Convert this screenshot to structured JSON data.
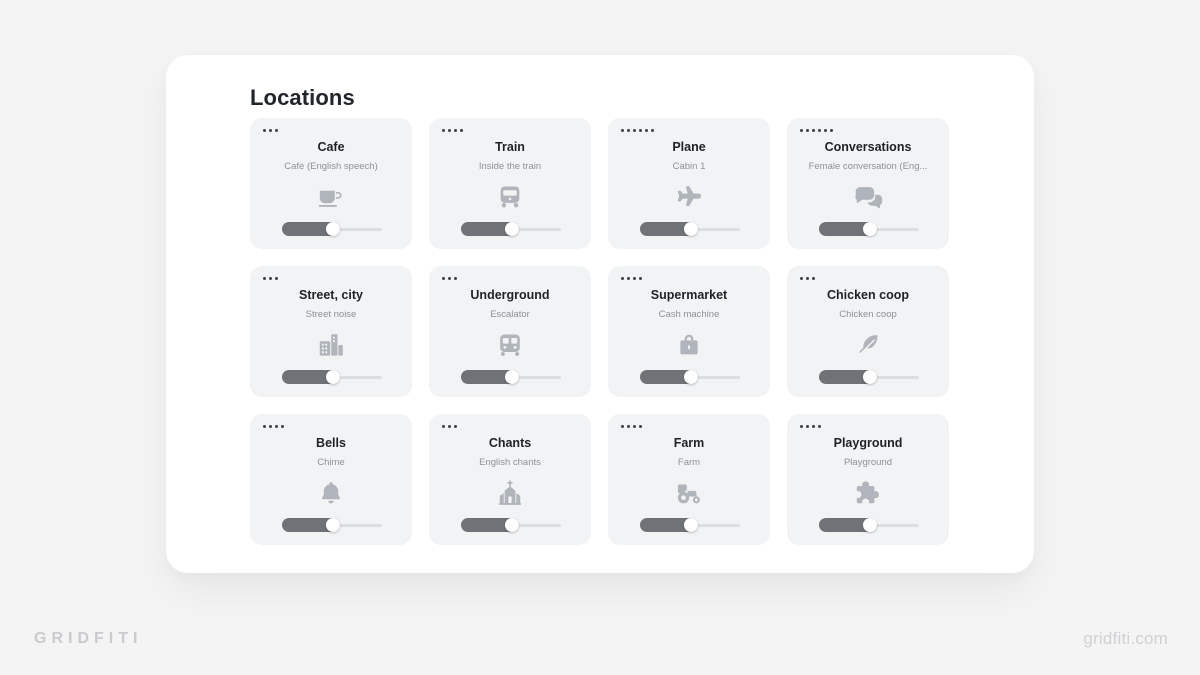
{
  "page": {
    "background_color": "#f4f4f4",
    "panel_color": "#ffffff",
    "card_color": "#f2f3f4",
    "slider_fill_color": "#6f7378",
    "slider_track_color": "#dcdee1"
  },
  "panel": {
    "title": "Locations"
  },
  "branding": {
    "left": "GRIDFITI",
    "right": "gridfiti.com"
  },
  "cards": [
    {
      "title": "Cafe",
      "subtitle": "Cafe (English speech)",
      "icon": "coffee-cup-icon",
      "dots": 3,
      "slider_percent": 58
    },
    {
      "title": "Train",
      "subtitle": "Inside the train",
      "icon": "train-front-icon",
      "dots": 4,
      "slider_percent": 58
    },
    {
      "title": "Plane",
      "subtitle": "Cabin 1",
      "icon": "airplane-icon",
      "dots": 6,
      "slider_percent": 58
    },
    {
      "title": "Conversations",
      "subtitle": "Female conversation (Eng...",
      "icon": "speech-bubbles-icon",
      "dots": 6,
      "slider_percent": 58
    },
    {
      "title": "Street, city",
      "subtitle": "Street noise",
      "icon": "city-buildings-icon",
      "dots": 3,
      "slider_percent": 58
    },
    {
      "title": "Underground",
      "subtitle": "Escalator",
      "icon": "metro-train-icon",
      "dots": 3,
      "slider_percent": 58
    },
    {
      "title": "Supermarket",
      "subtitle": "Cash machine",
      "icon": "shopping-bag-icon",
      "dots": 4,
      "slider_percent": 58
    },
    {
      "title": "Chicken coop",
      "subtitle": "Chicken coop",
      "icon": "feather-icon",
      "dots": 3,
      "slider_percent": 58
    },
    {
      "title": "Bells",
      "subtitle": "Chime",
      "icon": "bell-icon",
      "dots": 4,
      "slider_percent": 58
    },
    {
      "title": "Chants",
      "subtitle": "English chants",
      "icon": "church-icon",
      "dots": 3,
      "slider_percent": 58
    },
    {
      "title": "Farm",
      "subtitle": "Farm",
      "icon": "tractor-icon",
      "dots": 4,
      "slider_percent": 58
    },
    {
      "title": "Playground",
      "subtitle": "Playground",
      "icon": "puzzle-piece-icon",
      "dots": 4,
      "slider_percent": 58
    }
  ]
}
